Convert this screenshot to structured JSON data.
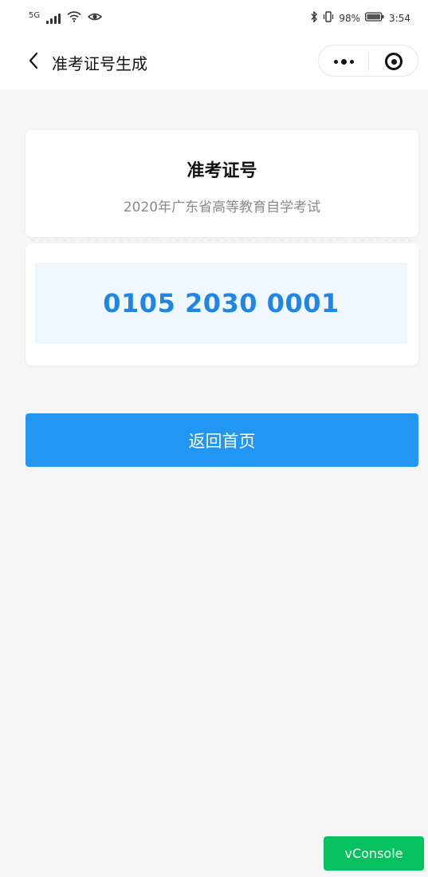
{
  "status_bar": {
    "signal_label": "5G",
    "battery_percent": "98%",
    "time": "3:54",
    "icons": [
      "signal-icon",
      "wifi-icon",
      "eye-icon",
      "bluetooth-icon",
      "vibrate-icon",
      "battery-icon"
    ]
  },
  "nav": {
    "title": "准考证号生成",
    "back_icon": "chevron-left-icon",
    "more_icon": "more-dots-icon",
    "target_icon": "target-icon"
  },
  "card": {
    "title": "准考证号",
    "subtitle": "2020年广东省高等教育自学考试",
    "ticket_number": "0105 2030 0001"
  },
  "actions": {
    "home_button": "返回首页"
  },
  "debug": {
    "vconsole_label": "vConsole"
  },
  "colors": {
    "primary": "#2196f3",
    "number_text": "#1f86e8",
    "number_bg": "#f1f7fe",
    "vconsole": "#07c160",
    "page_bg": "#f6f6f6"
  }
}
